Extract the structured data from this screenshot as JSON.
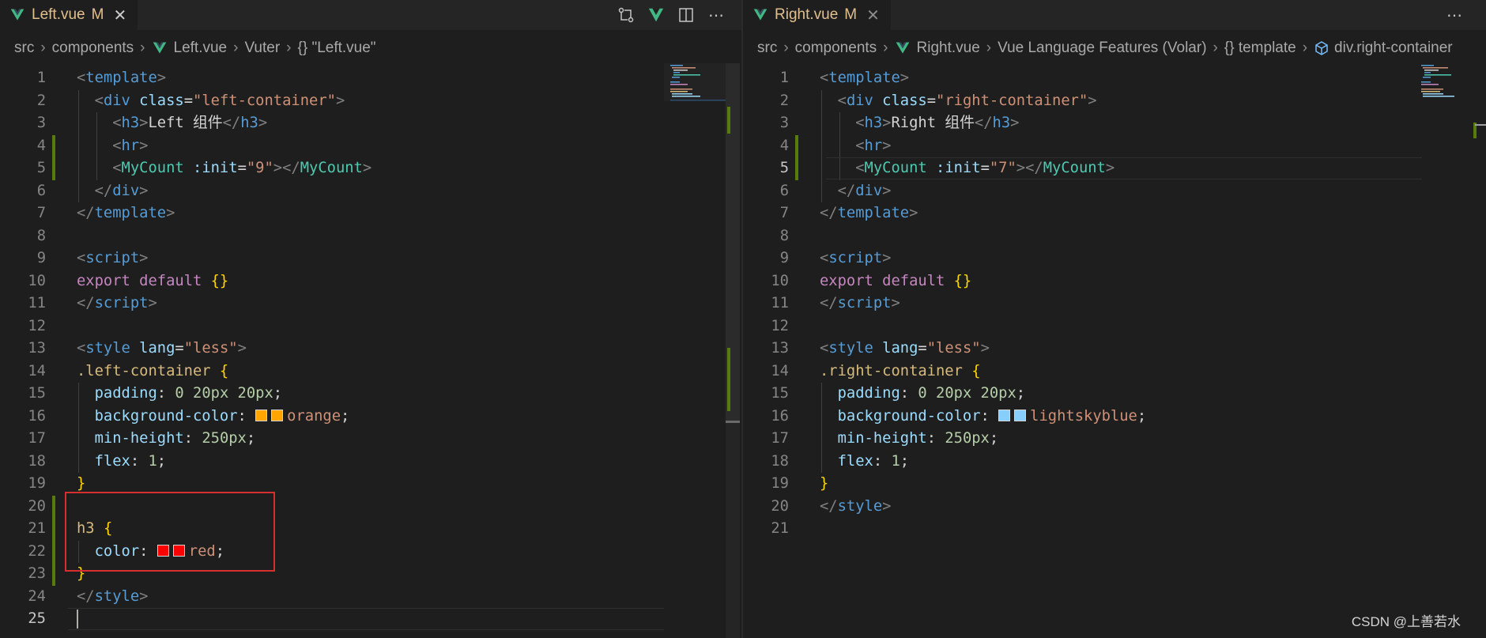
{
  "left": {
    "tab": {
      "name": "Left.vue",
      "badge": "M",
      "close": "✕"
    },
    "breadcrumb": [
      "src",
      "components",
      "Left.vue",
      "Vuter",
      "{} \"Left.vue\""
    ],
    "current_line": 25,
    "lines": [
      [
        [
          "p",
          "<"
        ],
        [
          "tag",
          "template"
        ],
        [
          "p",
          ">"
        ]
      ],
      [
        [
          "plain",
          "  "
        ],
        [
          "p",
          "<"
        ],
        [
          "tag",
          "div"
        ],
        [
          "plain",
          " "
        ],
        [
          "attr",
          "class"
        ],
        [
          "plain",
          "="
        ],
        [
          "str",
          "\"left-container\""
        ],
        [
          "p",
          ">"
        ]
      ],
      [
        [
          "plain",
          "    "
        ],
        [
          "p",
          "<"
        ],
        [
          "tag",
          "h3"
        ],
        [
          "p",
          ">"
        ],
        [
          "plain",
          "Left 组件"
        ],
        [
          "p",
          "</"
        ],
        [
          "tag",
          "h3"
        ],
        [
          "p",
          ">"
        ]
      ],
      [
        [
          "plain",
          "    "
        ],
        [
          "p",
          "<"
        ],
        [
          "tag",
          "hr"
        ],
        [
          "p",
          ">"
        ]
      ],
      [
        [
          "plain",
          "    "
        ],
        [
          "p",
          "<"
        ],
        [
          "cmp",
          "MyCount"
        ],
        [
          "plain",
          " "
        ],
        [
          "attr",
          ":init"
        ],
        [
          "plain",
          "="
        ],
        [
          "str",
          "\"9\""
        ],
        [
          "p",
          "></"
        ],
        [
          "cmp",
          "MyCount"
        ],
        [
          "p",
          ">"
        ]
      ],
      [
        [
          "plain",
          "  "
        ],
        [
          "p",
          "</"
        ],
        [
          "tag",
          "div"
        ],
        [
          "p",
          ">"
        ]
      ],
      [
        [
          "p",
          "</"
        ],
        [
          "tag",
          "template"
        ],
        [
          "p",
          ">"
        ]
      ],
      [],
      [
        [
          "p",
          "<"
        ],
        [
          "tag",
          "script"
        ],
        [
          "p",
          ">"
        ]
      ],
      [
        [
          "kw",
          "export"
        ],
        [
          "plain",
          " "
        ],
        [
          "kw",
          "default"
        ],
        [
          "plain",
          " "
        ],
        [
          "brace",
          "{}"
        ]
      ],
      [
        [
          "p",
          "</"
        ],
        [
          "tag",
          "script"
        ],
        [
          "p",
          ">"
        ]
      ],
      [],
      [
        [
          "p",
          "<"
        ],
        [
          "tag",
          "style"
        ],
        [
          "plain",
          " "
        ],
        [
          "attr",
          "lang"
        ],
        [
          "plain",
          "="
        ],
        [
          "str",
          "\"less\""
        ],
        [
          "p",
          ">"
        ]
      ],
      [
        [
          "sel",
          ".left-container"
        ],
        [
          "plain",
          " "
        ],
        [
          "brace",
          "{"
        ]
      ],
      [
        [
          "plain",
          "  "
        ],
        [
          "prop",
          "padding"
        ],
        [
          "plain",
          ": "
        ],
        [
          "num",
          "0 20px 20px"
        ],
        [
          "plain",
          ";"
        ]
      ],
      [
        [
          "plain",
          "  "
        ],
        [
          "prop",
          "background-color"
        ],
        [
          "plain",
          ": "
        ],
        [
          "swatch",
          "#ffa500"
        ],
        [
          "swatch",
          "#ffa500"
        ],
        [
          "str",
          "orange"
        ],
        [
          "plain",
          ";"
        ]
      ],
      [
        [
          "plain",
          "  "
        ],
        [
          "prop",
          "min-height"
        ],
        [
          "plain",
          ": "
        ],
        [
          "num",
          "250px"
        ],
        [
          "plain",
          ";"
        ]
      ],
      [
        [
          "plain",
          "  "
        ],
        [
          "prop",
          "flex"
        ],
        [
          "plain",
          ": "
        ],
        [
          "num",
          "1"
        ],
        [
          "plain",
          ";"
        ]
      ],
      [
        [
          "brace",
          "}"
        ]
      ],
      [],
      [
        [
          "sel",
          "h3"
        ],
        [
          "plain",
          " "
        ],
        [
          "brace",
          "{"
        ]
      ],
      [
        [
          "plain",
          "  "
        ],
        [
          "prop",
          "color"
        ],
        [
          "plain",
          ": "
        ],
        [
          "swatch",
          "#ff0000"
        ],
        [
          "swatch",
          "#ff0000"
        ],
        [
          "str",
          "red"
        ],
        [
          "plain",
          ";"
        ]
      ],
      [
        [
          "brace",
          "}"
        ]
      ],
      [
        [
          "p",
          "</"
        ],
        [
          "tag",
          "style"
        ],
        [
          "p",
          ">"
        ]
      ],
      []
    ]
  },
  "right": {
    "tab": {
      "name": "Right.vue",
      "badge": "M",
      "close": "✕"
    },
    "breadcrumb": [
      "src",
      "components",
      "Right.vue",
      "Vue Language Features (Volar)",
      "{} template",
      "div.right-container"
    ],
    "current_line": 5,
    "lines": [
      [
        [
          "p",
          "<"
        ],
        [
          "tag",
          "template"
        ],
        [
          "p",
          ">"
        ]
      ],
      [
        [
          "plain",
          "  "
        ],
        [
          "p",
          "<"
        ],
        [
          "tag",
          "div"
        ],
        [
          "plain",
          " "
        ],
        [
          "attr",
          "class"
        ],
        [
          "plain",
          "="
        ],
        [
          "str",
          "\"right-container\""
        ],
        [
          "p",
          ">"
        ]
      ],
      [
        [
          "plain",
          "    "
        ],
        [
          "p",
          "<"
        ],
        [
          "tag",
          "h3"
        ],
        [
          "p",
          ">"
        ],
        [
          "plain",
          "Right 组件"
        ],
        [
          "p",
          "</"
        ],
        [
          "tag",
          "h3"
        ],
        [
          "p",
          ">"
        ]
      ],
      [
        [
          "plain",
          "    "
        ],
        [
          "p",
          "<"
        ],
        [
          "tag",
          "hr"
        ],
        [
          "p",
          ">"
        ]
      ],
      [
        [
          "plain",
          "    "
        ],
        [
          "p",
          "<"
        ],
        [
          "cmp",
          "MyCount"
        ],
        [
          "plain",
          " "
        ],
        [
          "attr",
          ":init"
        ],
        [
          "plain",
          "="
        ],
        [
          "str",
          "\"7\""
        ],
        [
          "p",
          "></"
        ],
        [
          "cmp",
          "MyCount"
        ],
        [
          "p",
          ">"
        ]
      ],
      [
        [
          "plain",
          "  "
        ],
        [
          "p",
          "</"
        ],
        [
          "tag",
          "div"
        ],
        [
          "p",
          ">"
        ]
      ],
      [
        [
          "p",
          "</"
        ],
        [
          "tag",
          "template"
        ],
        [
          "p",
          ">"
        ]
      ],
      [],
      [
        [
          "p",
          "<"
        ],
        [
          "tag",
          "script"
        ],
        [
          "p",
          ">"
        ]
      ],
      [
        [
          "kw",
          "export"
        ],
        [
          "plain",
          " "
        ],
        [
          "kw",
          "default"
        ],
        [
          "plain",
          " "
        ],
        [
          "brace",
          "{}"
        ]
      ],
      [
        [
          "p",
          "</"
        ],
        [
          "tag",
          "script"
        ],
        [
          "p",
          ">"
        ]
      ],
      [],
      [
        [
          "p",
          "<"
        ],
        [
          "tag",
          "style"
        ],
        [
          "plain",
          " "
        ],
        [
          "attr",
          "lang"
        ],
        [
          "plain",
          "="
        ],
        [
          "str",
          "\"less\""
        ],
        [
          "p",
          ">"
        ]
      ],
      [
        [
          "sel",
          ".right-container"
        ],
        [
          "plain",
          " "
        ],
        [
          "brace",
          "{"
        ]
      ],
      [
        [
          "plain",
          "  "
        ],
        [
          "prop",
          "padding"
        ],
        [
          "plain",
          ": "
        ],
        [
          "num",
          "0 20px 20px"
        ],
        [
          "plain",
          ";"
        ]
      ],
      [
        [
          "plain",
          "  "
        ],
        [
          "prop",
          "background-color"
        ],
        [
          "plain",
          ": "
        ],
        [
          "swatch",
          "#87cefa"
        ],
        [
          "swatch",
          "#87cefa"
        ],
        [
          "str",
          "lightskyblue"
        ],
        [
          "plain",
          ";"
        ]
      ],
      [
        [
          "plain",
          "  "
        ],
        [
          "prop",
          "min-height"
        ],
        [
          "plain",
          ": "
        ],
        [
          "num",
          "250px"
        ],
        [
          "plain",
          ";"
        ]
      ],
      [
        [
          "plain",
          "  "
        ],
        [
          "prop",
          "flex"
        ],
        [
          "plain",
          ": "
        ],
        [
          "num",
          "1"
        ],
        [
          "plain",
          ";"
        ]
      ],
      [
        [
          "brace",
          "}"
        ]
      ],
      [
        [
          "p",
          "</"
        ],
        [
          "tag",
          "style"
        ],
        [
          "p",
          ">"
        ]
      ],
      []
    ]
  },
  "icons": {
    "vue": "vue-logo-icon",
    "more": "ellipsis-icon",
    "split": "split-editor-icon",
    "compare": "open-changes-icon",
    "volar": "volar-icon",
    "cube": "symbol-object-icon"
  },
  "colors": {
    "modified": "#e2c08d",
    "gutter_added": "#587c0c",
    "highlight_box": "#d72f2f"
  },
  "watermark": "CSDN @上善若水"
}
